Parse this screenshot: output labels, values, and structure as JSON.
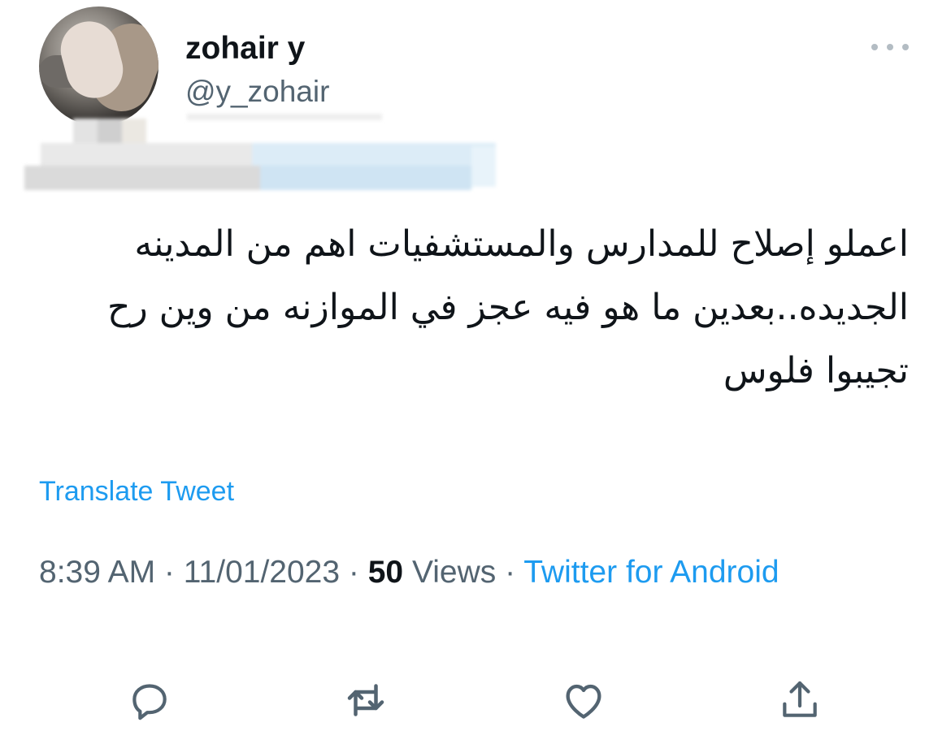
{
  "author": {
    "display_name": "zohair y",
    "handle": "@y_zohair"
  },
  "more_icon": "more-horizontal-icon",
  "tweet": {
    "text": "اعملو إصلاح للمدارس والمستشفيات اهم من المدينه الجديده..بعدين ما هو فيه عجز في الموازنه من وين رح تجيبوا فلوس"
  },
  "translate_label": "Translate Tweet",
  "meta": {
    "time": "8:39 AM",
    "sep1": " · ",
    "date": "11/01/2023",
    "sep2": " · ",
    "views_count": "50",
    "views_label": " Views",
    "sep3": " · ",
    "source": "Twitter for Android"
  },
  "actions": [
    {
      "icon": "reply-icon"
    },
    {
      "icon": "retweet-icon"
    },
    {
      "icon": "like-icon"
    },
    {
      "icon": "share-icon"
    }
  ],
  "colors": {
    "accent": "#1d9bf0",
    "text_primary": "#0f1419",
    "text_secondary": "#536471",
    "icon": "#536471"
  }
}
